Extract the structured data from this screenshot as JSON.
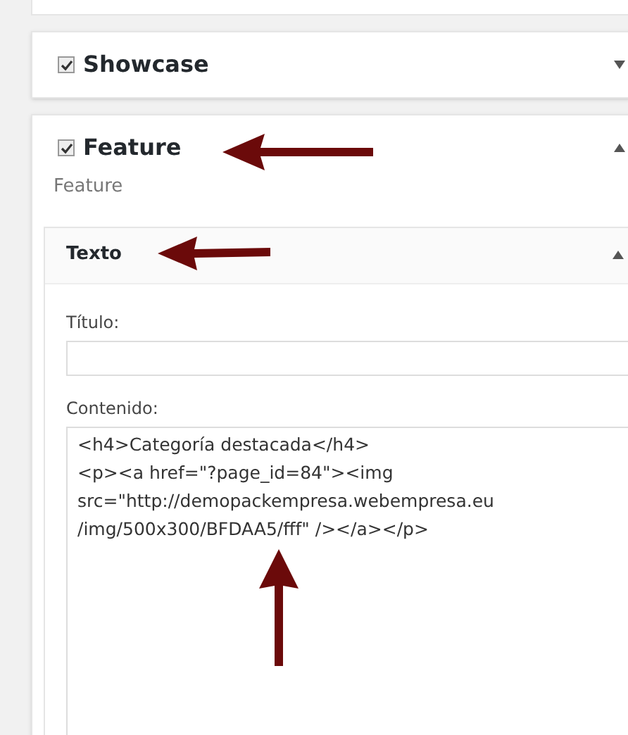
{
  "widgets": [
    {
      "title": "Showcase",
      "checked": true,
      "expanded": false
    },
    {
      "title": "Feature",
      "checked": true,
      "expanded": true,
      "description": "Feature",
      "section": {
        "title": "Texto",
        "expanded": true,
        "fields": [
          {
            "kind": "input",
            "label": "Título:"
          },
          {
            "kind": "textarea",
            "label": "Contenido:",
            "value": "<h4>Categoría destacada</h4>\n<p><a href=\"?page_id=84\"><img\nsrc=\"http://demopackempresa.webempresa.eu\n/img/500x300/BFDAA5/fff\" /></a></p>"
          }
        ]
      }
    }
  ]
}
